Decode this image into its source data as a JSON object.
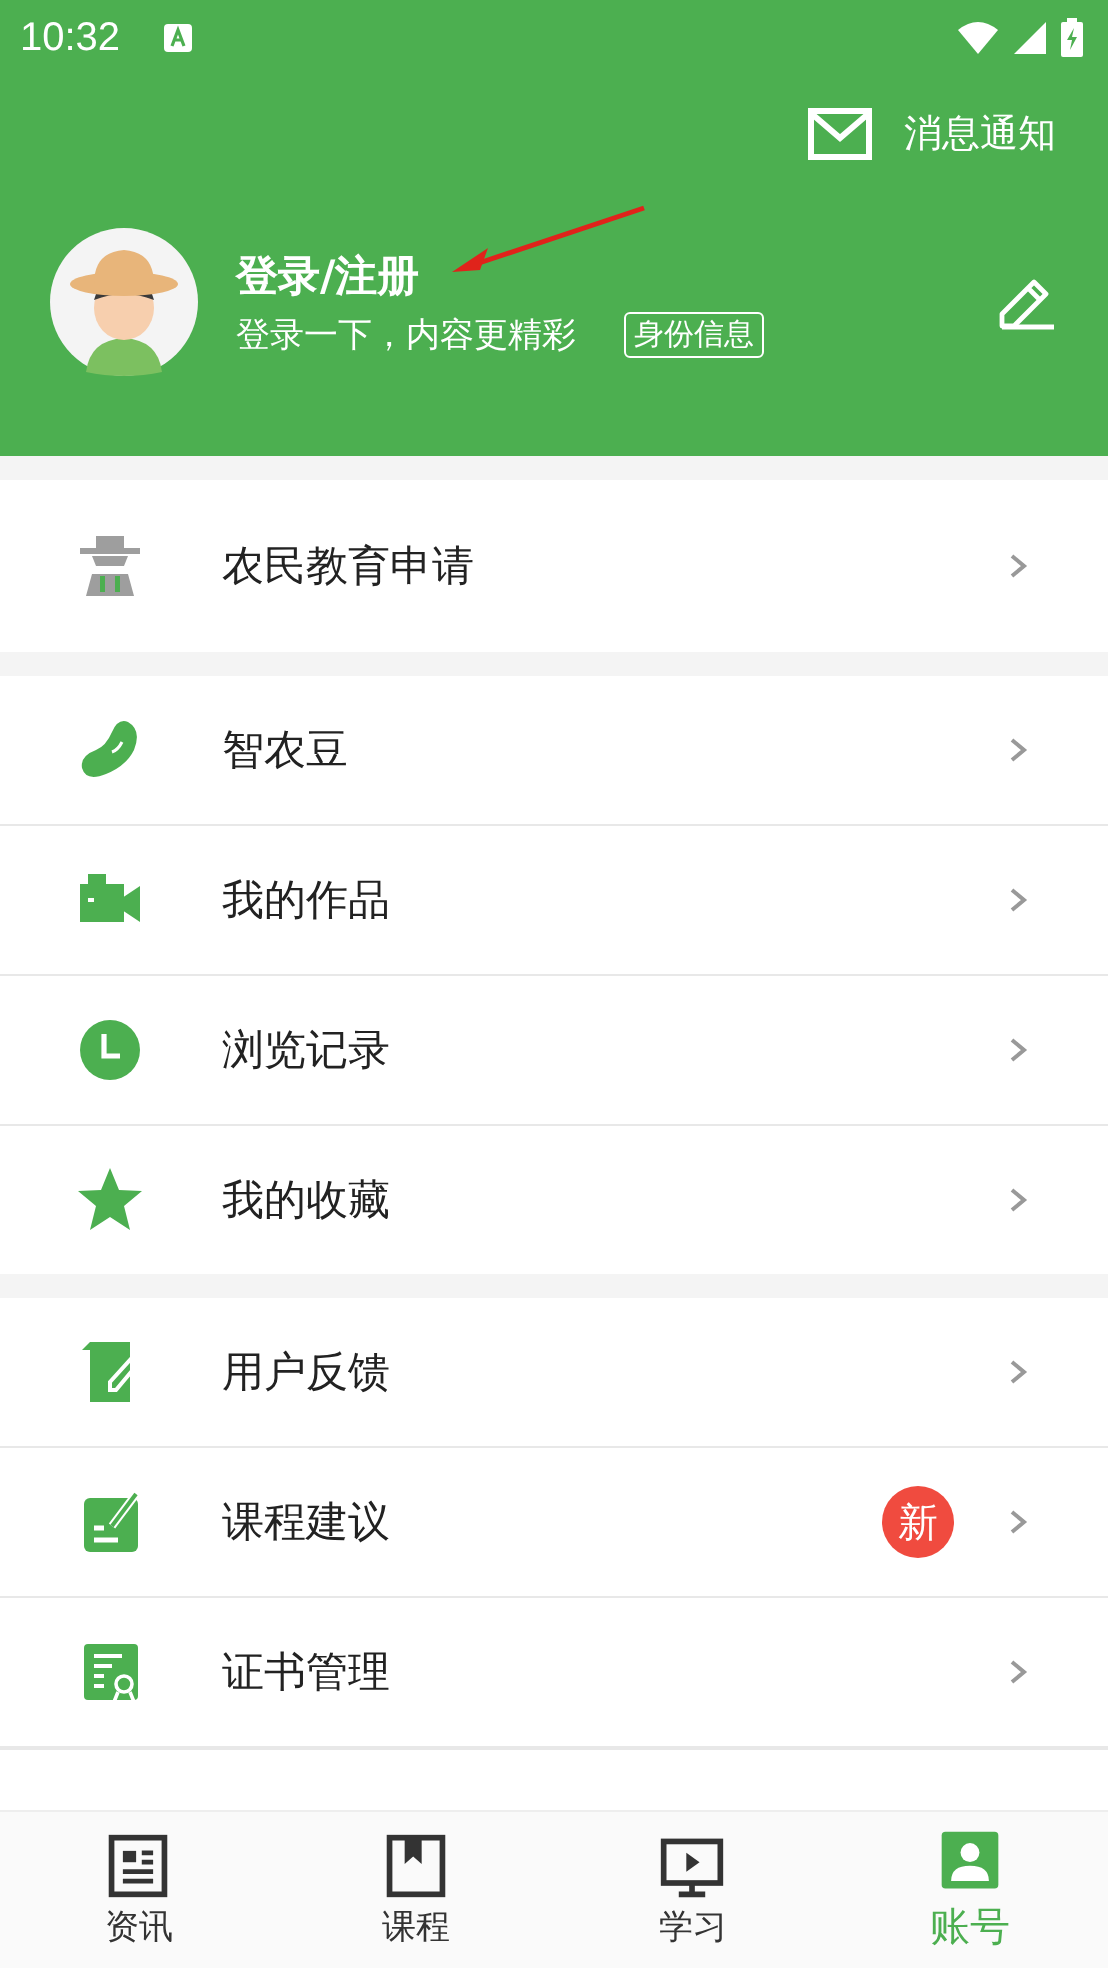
{
  "status_bar": {
    "time": "10:32"
  },
  "header": {
    "notify_label": "消息通知",
    "title": "登录/注册",
    "subtitle": "登录一下，内容更精彩",
    "identity_tag": "身份信息",
    "annotation": {
      "kind": "arrow"
    }
  },
  "sections": [
    {
      "items": [
        {
          "label": "农民教育申请"
        }
      ]
    },
    {
      "items": [
        {
          "label": "智农豆"
        },
        {
          "label": "我的作品"
        },
        {
          "label": "浏览记录"
        },
        {
          "label": "我的收藏"
        }
      ]
    },
    {
      "items": [
        {
          "label": "用户反馈"
        },
        {
          "label": "课程建议",
          "badge": "新"
        },
        {
          "label": "证书管理"
        }
      ]
    }
  ],
  "tabs": [
    {
      "label": "资讯",
      "selected": false
    },
    {
      "label": "课程",
      "selected": false
    },
    {
      "label": "学习",
      "selected": false
    },
    {
      "label": "账号",
      "selected": true
    }
  ]
}
